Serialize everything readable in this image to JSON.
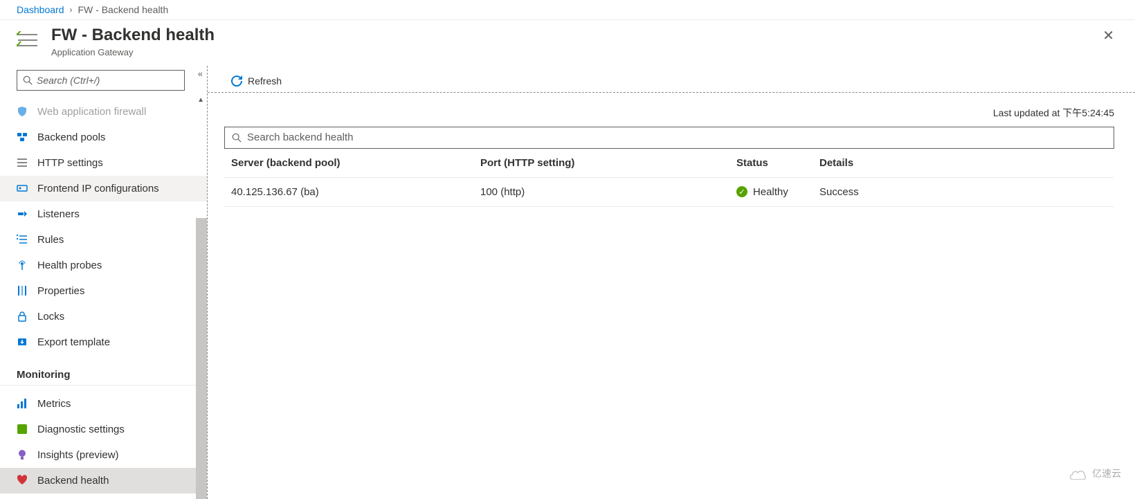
{
  "breadcrumb": {
    "root": "Dashboard",
    "current": "FW - Backend health"
  },
  "header": {
    "title": "FW - Backend health",
    "subtitle": "Application Gateway"
  },
  "search": {
    "placeholder": "Search (Ctrl+/)"
  },
  "sidebar": {
    "items": [
      {
        "id": "waf",
        "label": "Web application firewall",
        "icon": "shield-icon",
        "faded": true
      },
      {
        "id": "backend-pools",
        "label": "Backend pools",
        "icon": "pool-icon"
      },
      {
        "id": "http-settings",
        "label": "HTTP settings",
        "icon": "list-icon"
      },
      {
        "id": "frontend-ip",
        "label": "Frontend IP configurations",
        "icon": "ip-icon",
        "selected": true
      },
      {
        "id": "listeners",
        "label": "Listeners",
        "icon": "listener-icon"
      },
      {
        "id": "rules",
        "label": "Rules",
        "icon": "rules-icon"
      },
      {
        "id": "health-probes",
        "label": "Health probes",
        "icon": "probe-icon"
      },
      {
        "id": "properties",
        "label": "Properties",
        "icon": "properties-icon"
      },
      {
        "id": "locks",
        "label": "Locks",
        "icon": "lock-icon"
      },
      {
        "id": "export-template",
        "label": "Export template",
        "icon": "export-icon"
      }
    ],
    "section": "Monitoring",
    "monitoring": [
      {
        "id": "metrics",
        "label": "Metrics",
        "icon": "metrics-icon"
      },
      {
        "id": "diagnostic",
        "label": "Diagnostic settings",
        "icon": "diagnostic-icon"
      },
      {
        "id": "insights",
        "label": "Insights (preview)",
        "icon": "insights-icon"
      },
      {
        "id": "backend-health",
        "label": "Backend health",
        "icon": "heart-icon",
        "active": true
      }
    ]
  },
  "toolbar": {
    "refresh": "Refresh"
  },
  "last_updated": "Last updated at 下午5:24:45",
  "filter": {
    "placeholder": "Search backend health"
  },
  "table": {
    "headers": {
      "server": "Server (backend pool)",
      "port": "Port (HTTP setting)",
      "status": "Status",
      "details": "Details"
    },
    "rows": [
      {
        "server": "40.125.136.67 (ba)",
        "port": "100 (http)",
        "status": "Healthy",
        "details": "Success"
      }
    ]
  },
  "watermark": "亿速云"
}
